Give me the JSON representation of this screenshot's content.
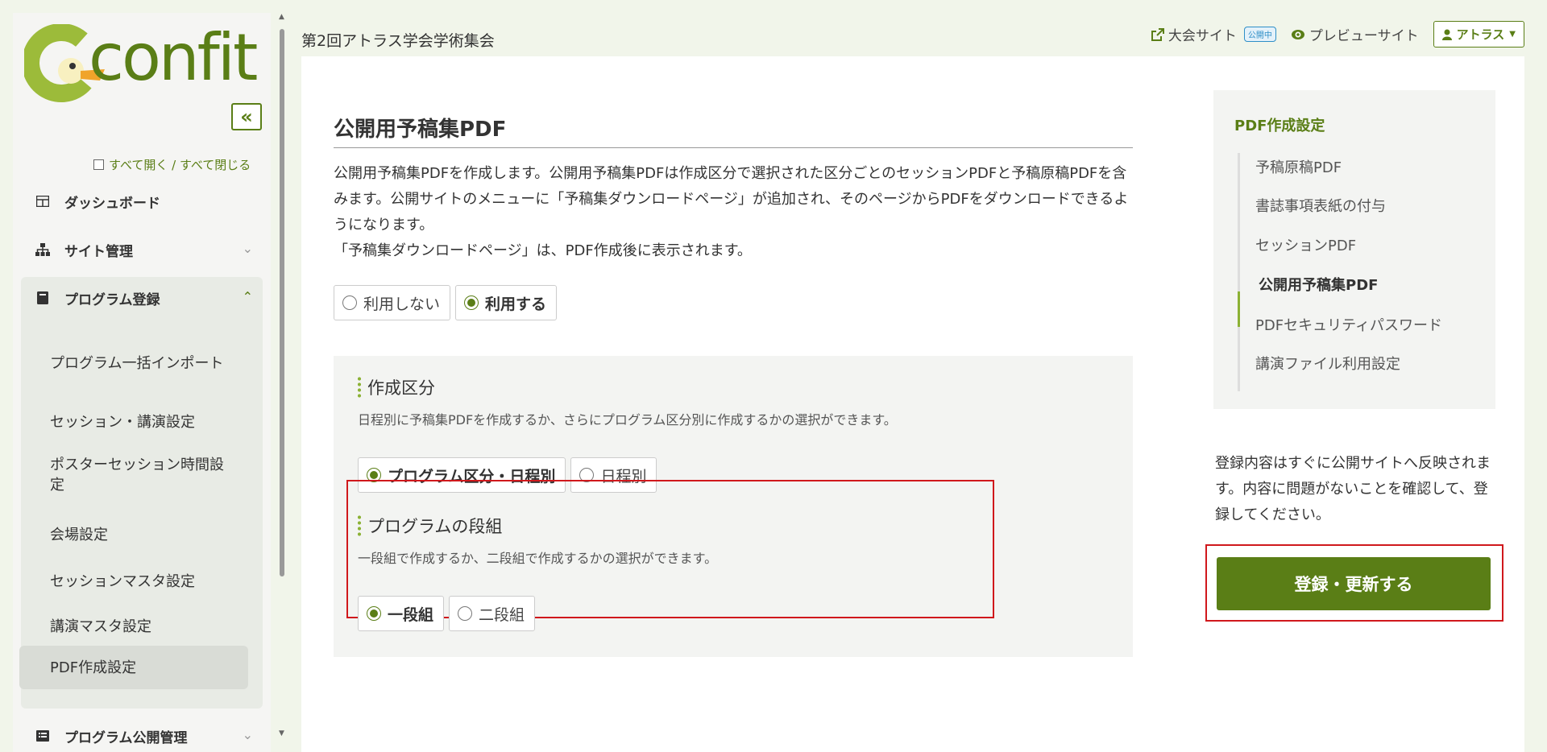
{
  "app": {
    "logo_text": "confit",
    "event_title": "第2回アトラス学会学術集会"
  },
  "sidebar": {
    "collapse_label": "«",
    "expand_all": "すべて開く / すべて閉じる",
    "items": [
      {
        "label": "ダッシュボード",
        "icon": "dashboard-icon"
      },
      {
        "label": "サイト管理",
        "icon": "sitemap-icon"
      },
      {
        "label": "プログラム登録",
        "icon": "book-icon"
      },
      {
        "label": "プログラム公開管理",
        "icon": "list-icon"
      }
    ],
    "sub_items": [
      {
        "label": "プログラム一括インポート"
      },
      {
        "label": "セッション・講演設定"
      },
      {
        "label": "ポスターセッション時間設定"
      },
      {
        "label": "会場設定"
      },
      {
        "label": "セッションマスタ設定"
      },
      {
        "label": "講演マスタ設定"
      },
      {
        "label": "PDF作成設定"
      }
    ]
  },
  "header": {
    "site_link": "大会サイト",
    "public_badge": "公開中",
    "preview_link": "プレビューサイト",
    "user_label": "アトラス"
  },
  "main": {
    "title": "公開用予稿集PDF",
    "description_1": "公開用予稿集PDFを作成します。公開用予稿集PDFは作成区分で選択された区分ごとのセッションPDFと予稿原稿PDFを含みます。公開サイトのメニューに「予稿集ダウンロードページ」が追加され、そのページからPDFをダウンロードできるようになります。",
    "description_2": "「予稿集ダウンロードページ」は、PDF作成後に表示されます。",
    "use_options": [
      {
        "label": "利用しない",
        "selected": false
      },
      {
        "label": "利用する",
        "selected": true
      }
    ],
    "creation_section": {
      "title": "作成区分",
      "description": "日程別に予稿集PDFを作成するか、さらにプログラム区分別に作成するかの選択ができます。",
      "options": [
        {
          "label": "プログラム区分・日程別",
          "selected": true
        },
        {
          "label": "日程別",
          "selected": false
        }
      ]
    },
    "column_section": {
      "title": "プログラムの段組",
      "description": "一段組で作成するか、二段組で作成するかの選択ができます。",
      "options": [
        {
          "label": "一段組",
          "selected": true
        },
        {
          "label": "二段組",
          "selected": false
        }
      ]
    }
  },
  "toc": {
    "title": "PDF作成設定",
    "items": [
      {
        "label": "予稿原稿PDF",
        "active": false
      },
      {
        "label": "書誌事項表紙の付与",
        "active": false
      },
      {
        "label": "セッションPDF",
        "active": false
      },
      {
        "label": "公開用予稿集PDF",
        "active": true
      },
      {
        "label": "PDFセキュリティパスワード",
        "active": false
      },
      {
        "label": "講演ファイル利用設定",
        "active": false
      }
    ]
  },
  "notice": "登録内容はすぐに公開サイトへ反映されます。内容に問題がないことを確認して、登録してください。",
  "submit_label": "登録・更新する",
  "colors": {
    "brand": "#5a7e16",
    "accent": "#8bb134",
    "highlight": "#d0181c",
    "badge": "#2f8fc7"
  }
}
